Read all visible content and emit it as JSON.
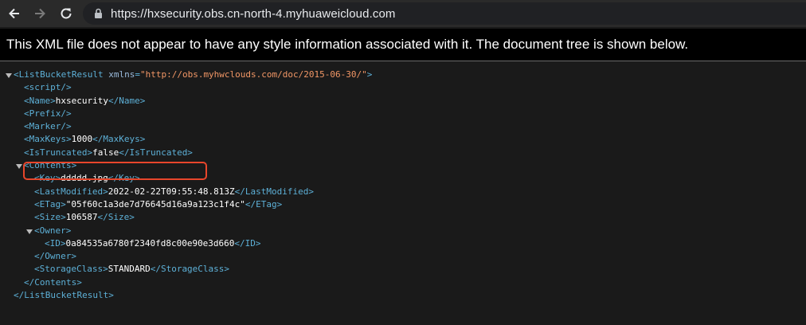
{
  "browser": {
    "url": "https://hxsecurity.obs.cn-north-4.myhuaweicloud.com"
  },
  "notice": "This XML file does not appear to have any style information associated with it. The document tree is shown below.",
  "xml": {
    "root_open": "<ListBucketResult",
    "root_attr_name": "xmlns",
    "root_attr_value": "\"http://obs.myhwclouds.com/doc/2015-06-30/\"",
    "root_open_end": ">",
    "script": "<script/>",
    "name_open": "<Name>",
    "name_value": "hxsecurity",
    "name_close": "</Name>",
    "prefix": "<Prefix/>",
    "marker": "<Marker/>",
    "maxkeys_open": "<MaxKeys>",
    "maxkeys_value": "1000",
    "maxkeys_close": "</MaxKeys>",
    "istruncated_open": "<IsTruncated>",
    "istruncated_value": "false",
    "istruncated_close": "</IsTruncated>",
    "contents_open": "<Contents>",
    "key_open": "<Key>",
    "key_value": "ddddd.jpg",
    "key_close": "</Key>",
    "lastmod_open": "<LastModified>",
    "lastmod_value": "2022-02-22T09:55:48.813Z",
    "lastmod_close": "</LastModified>",
    "etag_open": "<ETag>",
    "etag_value": "\"05f60c1a3de7d76645d16a9a123c1f4c\"",
    "etag_close": "</ETag>",
    "size_open": "<Size>",
    "size_value": "106587",
    "size_close": "</Size>",
    "owner_open": "<Owner>",
    "id_open": "<ID>",
    "id_value": "0a84535a6780f2340fd8c00e90e3d660",
    "id_close": "</ID>",
    "owner_close": "</Owner>",
    "storage_open": "<StorageClass>",
    "storage_value": "STANDARD",
    "storage_close": "</StorageClass>",
    "contents_close": "</Contents>",
    "root_close": "</ListBucketResult>"
  },
  "colors": {
    "tag": "#5db0d7",
    "attr_value": "#f29766",
    "highlight": "#e8462b"
  }
}
